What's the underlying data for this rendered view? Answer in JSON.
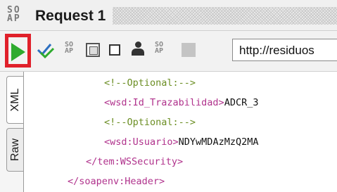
{
  "window": {
    "icon_top": "SO",
    "icon_bottom": "AP",
    "title": "Request 1"
  },
  "toolbar": {
    "run_icon": "play-icon",
    "icons": [
      "check-icon",
      "soap-small-icon",
      "frame-icon",
      "square-icon",
      "user-icon",
      "soap-small-icon",
      "gray-square-icon"
    ],
    "sa_top": "SO",
    "sa_bottom": "AP",
    "url": "http://residuos"
  },
  "tabs": {
    "xml": "XML",
    "raw": "Raw"
  },
  "editor": {
    "lines": [
      {
        "type": "comment",
        "text": "<!--Optional:-->"
      },
      {
        "type": "element",
        "open": "<wsd:Id_Trazabilidad>",
        "value": "ADCR_3"
      },
      {
        "type": "comment",
        "text": "<!--Optional:-->"
      },
      {
        "type": "element",
        "open": "<wsd:Usuario>",
        "value": "NDYwMDAzMzQ2MA"
      },
      {
        "type": "close",
        "text": "</tem:WSSecurity>"
      },
      {
        "type": "close",
        "text": "</soapenv:Header>"
      }
    ]
  },
  "colors": {
    "run": "#2eaa2e",
    "highlight_border": "#e0202a",
    "comment": "#6b8e23",
    "tag": "#b0328c"
  }
}
